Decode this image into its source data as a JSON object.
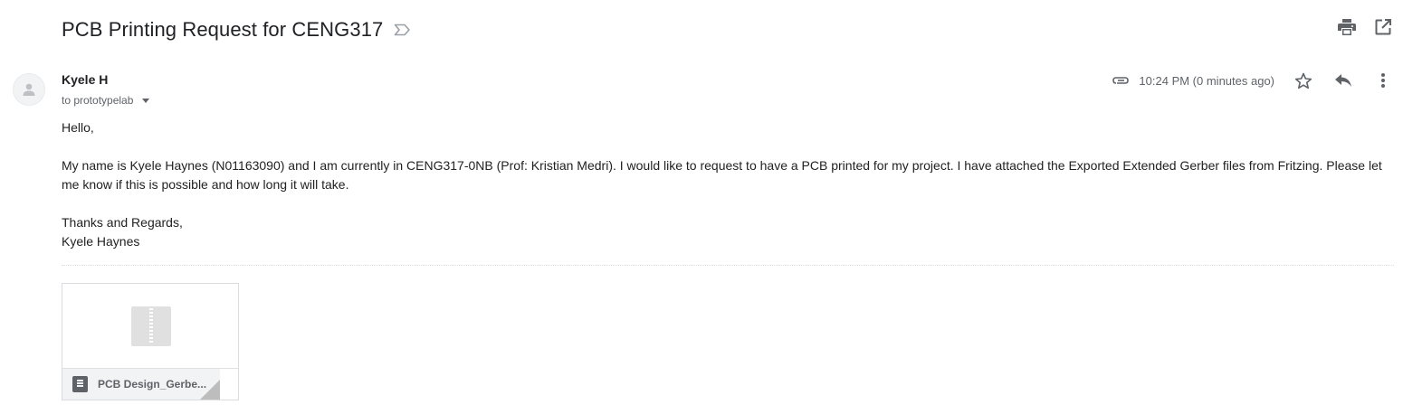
{
  "thread": {
    "subject": "PCB Printing Request for CENG317"
  },
  "message": {
    "sender": "Kyele H",
    "recipient": "to prototypelab",
    "time": "10:24 PM (0 minutes ago)",
    "body": {
      "greeting": "Hello,",
      "paragraph": "My name is Kyele Haynes (N01163090) and I am currently in CENG317-0NB (Prof: Kristian Medri). I would like to request to have a PCB printed for my project. I have attached the Exported Extended Gerber files from Fritzing. Please let me know if this is possible and how long it will take.",
      "closing": "Thanks and Regards,",
      "signature": "Kyele Haynes"
    }
  },
  "attachment": {
    "name": "PCB Design_Gerbe..."
  },
  "icons": {
    "label": "label-outline-icon",
    "print": "print-icon",
    "open_new_window": "open-in-new-icon",
    "avatar": "person-icon",
    "attachment_clip": "paperclip-icon",
    "star": "star-outline-icon",
    "reply": "reply-icon",
    "more": "more-vert-icon",
    "zip": "zip-file-icon",
    "doc": "document-icon"
  },
  "colors": {
    "text": "#202124",
    "secondary": "#5f6368",
    "icon": "#5f6368",
    "divider": "#dadce0"
  }
}
